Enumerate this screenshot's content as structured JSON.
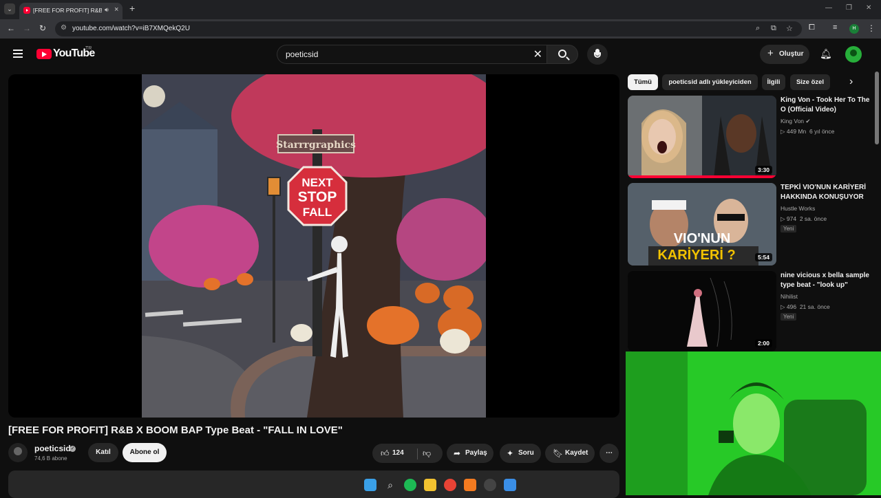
{
  "browser": {
    "tab_title": "[FREE FOR PROFIT] R&B X B",
    "new_tab": "+",
    "url": "youtube.com/watch?v=iB7XMQekQ2U",
    "profile_initial": "H"
  },
  "youtube": {
    "logo_text": "YouTube",
    "country_code": "TR",
    "search_query": "poeticsid",
    "create_label": "Oluştur"
  },
  "video": {
    "title": "[FREE FOR PROFIT] R&B X BOOM BAP Type Beat - \"FALL IN LOVE\"",
    "art_sign_top": "Starrrgraphics",
    "art_sign_stop_1": "NEXT",
    "art_sign_stop_2": "STOP",
    "art_sign_stop_3": "FALL",
    "channel_name": "poeticsid",
    "subscribers": "74,6 B abone",
    "join_label": "Katıl",
    "subscribe_label": "Abone ol",
    "like_count": "124",
    "share_label": "Paylaş",
    "ask_label": "Soru",
    "save_label": "Kaydet"
  },
  "chips": [
    "Tümü",
    "poeticsid adlı yükleyiciden",
    "İlgili",
    "Size özel"
  ],
  "recommendations": [
    {
      "title": "King Von - Took Her To The O (Official Video)",
      "channel": "King Von",
      "views": "449 Mn",
      "age": "6 yıl önce",
      "duration": "3:30",
      "badge": ""
    },
    {
      "title": "TEPKİ VIO'NUN KARİYERİ HAKKINDA KONUŞUYOR",
      "channel": "Hustle Works",
      "views": "974",
      "age": "2 sa. önce",
      "duration": "5:54",
      "badge": "Yeni",
      "thumb_text_1": "VIO'NUN",
      "thumb_text_2": "KARİYERİ ?"
    },
    {
      "title": "nine vicious x bella sample type beat - \"look up\"",
      "channel": "Nihilist",
      "views": "496",
      "age": "21 sa. önce",
      "duration": "2:00",
      "badge": "Yeni"
    }
  ],
  "colors": {
    "brand_red": "#ff0033",
    "bg": "#0f0f0f",
    "surface": "#272727",
    "webcam_green": "#2ad12a"
  }
}
